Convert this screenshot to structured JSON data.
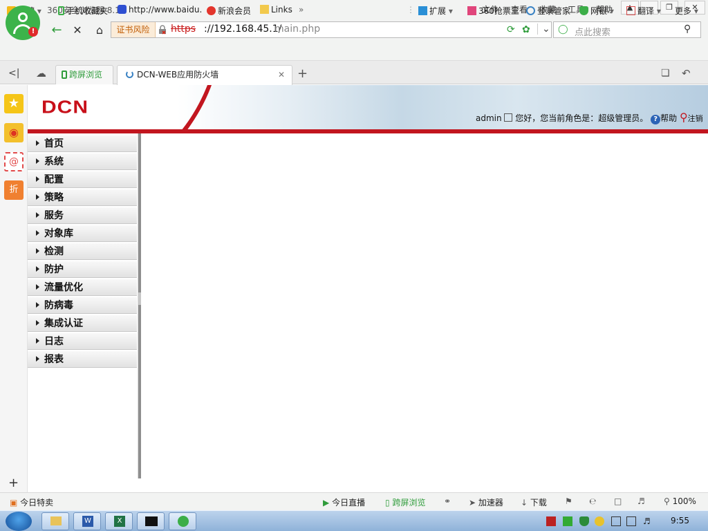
{
  "browser": {
    "app_title": "360安全浏览器 8.1",
    "menu": [
      "文件",
      "查看",
      "收藏",
      "工具",
      "帮助"
    ],
    "address": {
      "cert_warning": "证书风险",
      "scheme": "https",
      "host": "://192.168.45.1/",
      "path": "main.php"
    },
    "search_placeholder": "点此搜索",
    "favorites_left": [
      {
        "label": "收藏",
        "icon": "star-plus-icon"
      },
      {
        "label": "手机收藏夹",
        "icon": "phone-icon"
      },
      {
        "label": "http://www.baidu.",
        "icon": "baidu-paw-icon"
      },
      {
        "label": "新浪会员",
        "icon": "weibo-icon"
      },
      {
        "label": "Links",
        "icon": "folder-icon"
      }
    ],
    "favorites_right": [
      {
        "label": "扩展",
        "icon": "extension-icon"
      },
      {
        "label": "360抢票王",
        "icon": "ticket-icon"
      },
      {
        "label": "登录管家",
        "icon": "key-search-icon"
      },
      {
        "label": "网银",
        "icon": "shield-yen-icon"
      },
      {
        "label": "翻译",
        "icon": "translate-icon"
      },
      {
        "label": "更多",
        "icon": "more-icon"
      }
    ],
    "tabs": [
      {
        "label": "跨屏浏览",
        "active": false
      },
      {
        "label": "DCN-WEB应用防火墙",
        "active": true
      }
    ],
    "status_left": "今日特卖",
    "status_right": [
      {
        "label": "今日直播"
      },
      {
        "label": "跨屏浏览"
      },
      {
        "label": "加速器"
      },
      {
        "label": "下载"
      }
    ],
    "zoom": "100%"
  },
  "page": {
    "logo": "DCN",
    "username": "admin",
    "role_text": "您好，您当前角色是：超级管理员。",
    "help": "帮助",
    "logout": "注销",
    "nav_items": [
      "首页",
      "系统",
      "配置",
      "策略",
      "服务",
      "对象库",
      "检测",
      "防护",
      "流量优化",
      "防病毒",
      "集成认证",
      "日志",
      "报表"
    ]
  },
  "taskbar": {
    "clock": "9:55"
  }
}
